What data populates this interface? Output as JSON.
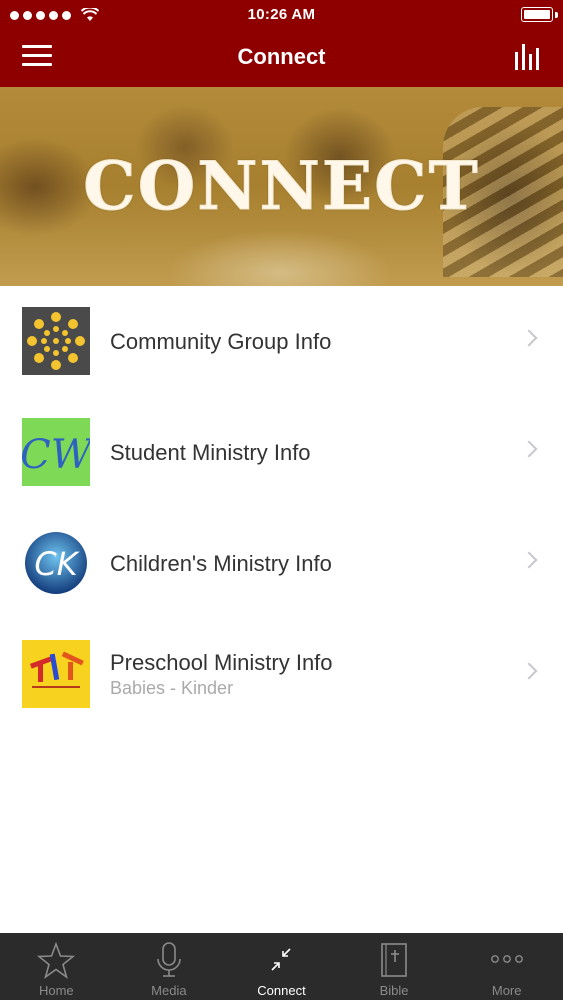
{
  "status_bar": {
    "time": "10:26 AM"
  },
  "nav": {
    "title": "Connect"
  },
  "banner": {
    "title": "CONNECT"
  },
  "items": [
    {
      "title": "Community Group Info",
      "subtitle": "",
      "icon": "community-dots-icon"
    },
    {
      "title": "Student Ministry Info",
      "subtitle": "",
      "icon": "cw-logo"
    },
    {
      "title": "Children's Ministry Info",
      "subtitle": "",
      "icon": "ck-logo"
    },
    {
      "title": "Preschool Ministry Info",
      "subtitle": "Babies - Kinder",
      "icon": "tools-logo"
    }
  ],
  "logos": {
    "student": "CW",
    "children": "CK"
  },
  "tabs": [
    {
      "label": "Home",
      "icon": "star-icon",
      "active": false
    },
    {
      "label": "Media",
      "icon": "microphone-icon",
      "active": false
    },
    {
      "label": "Connect",
      "icon": "connect-arrows-icon",
      "active": true
    },
    {
      "label": "Bible",
      "icon": "bible-icon",
      "active": false
    },
    {
      "label": "More",
      "icon": "more-dots-icon",
      "active": false
    }
  ],
  "colors": {
    "brand": "#8e0000",
    "tab_bar": "#2b2b2b",
    "text": "#333333",
    "subtext": "#aaaaaa"
  }
}
